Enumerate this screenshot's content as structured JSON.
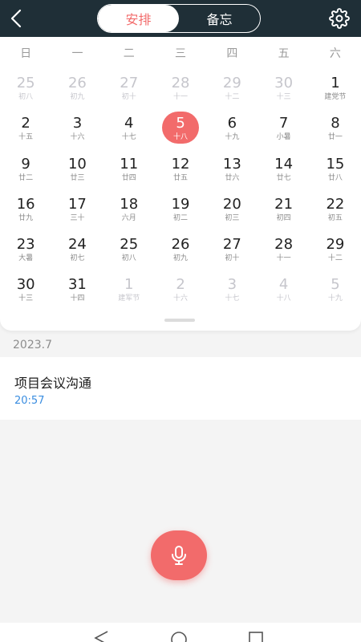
{
  "header": {
    "tabs": [
      {
        "label": "安排",
        "active": true
      },
      {
        "label": "备忘",
        "active": false
      }
    ],
    "back_icon": "chevron-left-icon",
    "settings_icon": "gear-icon"
  },
  "calendar": {
    "weekdays": [
      "日",
      "一",
      "二",
      "三",
      "四",
      "五",
      "六"
    ],
    "weeks": [
      [
        {
          "day": "25",
          "lunar": "初八",
          "other": true
        },
        {
          "day": "26",
          "lunar": "初九",
          "other": true
        },
        {
          "day": "27",
          "lunar": "初十",
          "other": true
        },
        {
          "day": "28",
          "lunar": "十一",
          "other": true
        },
        {
          "day": "29",
          "lunar": "十二",
          "other": true
        },
        {
          "day": "30",
          "lunar": "十三",
          "other": true
        },
        {
          "day": "1",
          "lunar": "建党节",
          "other": false
        }
      ],
      [
        {
          "day": "2",
          "lunar": "十五",
          "other": false
        },
        {
          "day": "3",
          "lunar": "十六",
          "other": false
        },
        {
          "day": "4",
          "lunar": "十七",
          "other": false
        },
        {
          "day": "5",
          "lunar": "十八",
          "other": false,
          "selected": true
        },
        {
          "day": "6",
          "lunar": "十九",
          "other": false
        },
        {
          "day": "7",
          "lunar": "小暑",
          "other": false
        },
        {
          "day": "8",
          "lunar": "廿一",
          "other": false
        }
      ],
      [
        {
          "day": "9",
          "lunar": "廿二",
          "other": false
        },
        {
          "day": "10",
          "lunar": "廿三",
          "other": false
        },
        {
          "day": "11",
          "lunar": "廿四",
          "other": false
        },
        {
          "day": "12",
          "lunar": "廿五",
          "other": false
        },
        {
          "day": "13",
          "lunar": "廿六",
          "other": false
        },
        {
          "day": "14",
          "lunar": "廿七",
          "other": false
        },
        {
          "day": "15",
          "lunar": "廿八",
          "other": false
        }
      ],
      [
        {
          "day": "16",
          "lunar": "廿九",
          "other": false
        },
        {
          "day": "17",
          "lunar": "三十",
          "other": false
        },
        {
          "day": "18",
          "lunar": "六月",
          "other": false
        },
        {
          "day": "19",
          "lunar": "初二",
          "other": false
        },
        {
          "day": "20",
          "lunar": "初三",
          "other": false
        },
        {
          "day": "21",
          "lunar": "初四",
          "other": false
        },
        {
          "day": "22",
          "lunar": "初五",
          "other": false
        }
      ],
      [
        {
          "day": "23",
          "lunar": "大暑",
          "other": false
        },
        {
          "day": "24",
          "lunar": "初七",
          "other": false
        },
        {
          "day": "25",
          "lunar": "初八",
          "other": false
        },
        {
          "day": "26",
          "lunar": "初九",
          "other": false
        },
        {
          "day": "27",
          "lunar": "初十",
          "other": false
        },
        {
          "day": "28",
          "lunar": "十一",
          "other": false
        },
        {
          "day": "29",
          "lunar": "十二",
          "other": false
        }
      ],
      [
        {
          "day": "30",
          "lunar": "十三",
          "other": false
        },
        {
          "day": "31",
          "lunar": "十四",
          "other": false
        },
        {
          "day": "1",
          "lunar": "建军节",
          "other": true
        },
        {
          "day": "2",
          "lunar": "十六",
          "other": true
        },
        {
          "day": "3",
          "lunar": "十七",
          "other": true
        },
        {
          "day": "4",
          "lunar": "十八",
          "other": true
        },
        {
          "day": "5",
          "lunar": "十九",
          "other": true
        }
      ]
    ]
  },
  "schedule": {
    "month_label": "2023.7",
    "events": [
      {
        "title": "项目会议沟通",
        "time": "20:57"
      }
    ]
  },
  "fab": {
    "icon": "microphone-icon"
  },
  "colors": {
    "accent": "#f26b6b",
    "header_bg": "#1f2f37",
    "time_text": "#3a8de0",
    "page_bg": "#f4f4f4"
  }
}
